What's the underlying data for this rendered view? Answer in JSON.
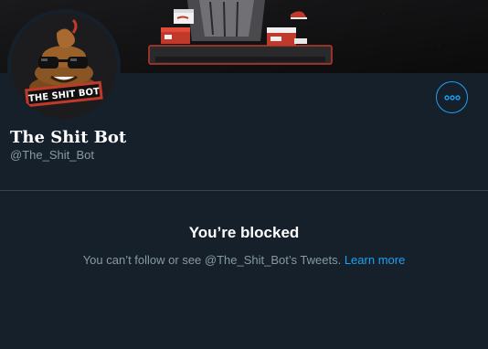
{
  "colors": {
    "background": "#15202b",
    "accent": "#1da1f2",
    "secondary_text": "#8899a6",
    "divider": "#38444d"
  },
  "banner": {
    "description_icons": [
      "shoe-box-icon",
      "sneaker-icon",
      "throne-icon"
    ]
  },
  "avatar": {
    "logo_text": "THE SHIT BOT",
    "icon": "poop-emoji-with-sunglasses-icon"
  },
  "more_button": {
    "icon": "more-horizontal-icon"
  },
  "profile": {
    "display_name": "The Shit Bot",
    "handle": "@The_Shit_Bot"
  },
  "blocked": {
    "title": "You’re blocked",
    "message": "You can’t follow or see @The_Shit_Bot’s Tweets.",
    "learn_more": "Learn more"
  }
}
